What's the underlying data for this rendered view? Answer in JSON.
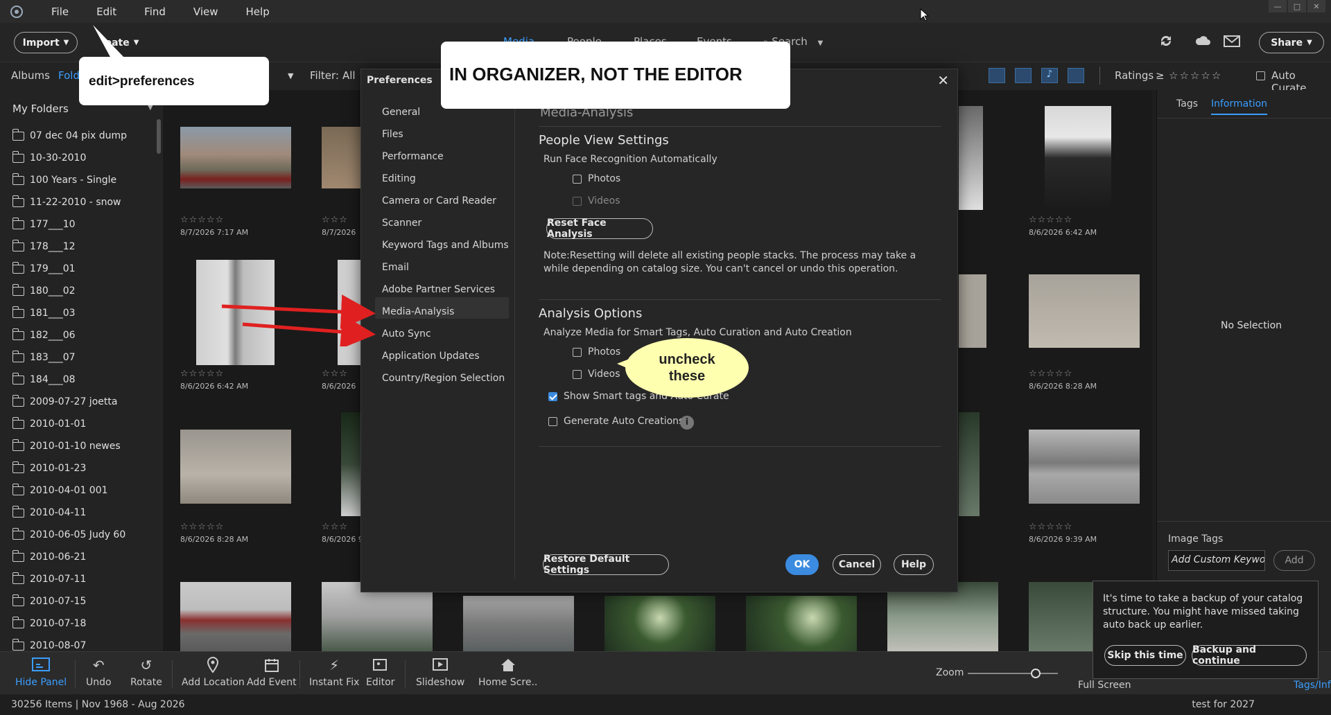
{
  "menubar": {
    "items": [
      "File",
      "Edit",
      "Find",
      "View",
      "Help"
    ]
  },
  "toolbar": {
    "import_label": "Import",
    "create_label": "eate",
    "nav": [
      "Media",
      "People",
      "Places",
      "Events"
    ],
    "search_label": "Search",
    "share_label": "Share"
  },
  "subbar": {
    "albums_label": "Albums",
    "folders_label": "Folde",
    "filter_label": "Filter:",
    "filter_value": "All",
    "ratings_label": "Ratings",
    "ratings_op": "≥",
    "auto_curate_label": "Auto Curate"
  },
  "leftpanel": {
    "header": "My Folders",
    "folders": [
      "07 dec 04 pix dump",
      "10-30-2010",
      "100 Years - Single",
      "11-22-2010 - snow",
      "177___10",
      "178___12",
      "179___01",
      "180___02",
      "181___03",
      "182___06",
      "183___07",
      "184___08",
      "2009-07-27 joetta",
      "2010-01-01",
      "2010-01-10 newes",
      "2010-01-23",
      "2010-04-01 001",
      "2010-04-11",
      "2010-06-05 Judy 60",
      "2010-06-21",
      "2010-07-11",
      "2010-07-15",
      "2010-07-18",
      "2010-08-07"
    ]
  },
  "grid": {
    "stars": "☆☆☆☆☆",
    "dates": [
      "8/7/2026 7:17 AM",
      "8/7/2026",
      "8/6/2026 6:42 AM",
      "8/6/2026 6:42 AM",
      "8/6/2026",
      "8/6/2026 8:28 AM",
      "8/6/2026 8:28 AM",
      "8/6/2026 9",
      "8/6/2026 9:39 AM"
    ]
  },
  "rightpanel": {
    "tabs": [
      "Tags",
      "Information"
    ],
    "no_selection": "No Selection",
    "image_tags_label": "Image Tags",
    "keyword_placeholder": "Add Custom Keywords",
    "add_label": "Add"
  },
  "bottombar": {
    "buttons": [
      "Hide Panel",
      "Undo",
      "Rotate",
      "Add Location",
      "Add Event",
      "Instant Fix",
      "Editor",
      "Slideshow",
      "Home Scre.."
    ],
    "zoom_label": "Zoom",
    "zoom_level": 0.75,
    "fullscreen_label": "Full Screen",
    "tagsinfo_label": "Tags/Info"
  },
  "status": {
    "items_text": "30256 Items | Nov 1968 - Aug 2026",
    "catalog_name": "test for 2027"
  },
  "prefs": {
    "title": "Preferences",
    "nav": [
      "General",
      "Files",
      "Performance",
      "Editing",
      "Camera or Card Reader",
      "Scanner",
      "Keyword Tags and Albums",
      "Email",
      "Adobe Partner Services",
      "Media-Analysis",
      "Auto Sync",
      "Application Updates",
      "Country/Region Selection"
    ],
    "page_title": "Media-Analysis",
    "people_title": "People View Settings",
    "run_face_label": "Run Face Recognition Automatically",
    "photos_label": "Photos",
    "videos_label": "Videos",
    "reset_face_label": "Reset Face Analysis",
    "note_text": "Note:Resetting will delete all existing people stacks. The process may take a while depending on catalog size. You can't cancel or undo this operation.",
    "analysis_title": "Analysis Options",
    "analyze_label": "Analyze Media for Smart Tags, Auto Curation and Auto Creation",
    "photos2_label": "Photos",
    "videos2_label": "Videos",
    "show_smart_label": "Show Smart tags and Auto Curate",
    "gen_auto_label": "Generate Auto Creations",
    "restore_label": "Restore Default Settings",
    "ok_label": "OK",
    "cancel_label": "Cancel",
    "help_label": "Help"
  },
  "annotations": {
    "edit_prefs": "edit>preferences",
    "organizer_note": "IN ORGANIZER, NOT THE EDITOR",
    "uncheck_note": "uncheck these"
  },
  "backup": {
    "message": "It's time to take a backup of your catalog structure. You might have missed taking auto back up earlier.",
    "skip_label": "Skip this time",
    "continue_label": "Backup and continue"
  },
  "colors": {
    "accent": "#3b9eff",
    "primary_button": "#3b8be0",
    "annotation_arrow": "#e02020",
    "bubble": "#ffffb0"
  }
}
